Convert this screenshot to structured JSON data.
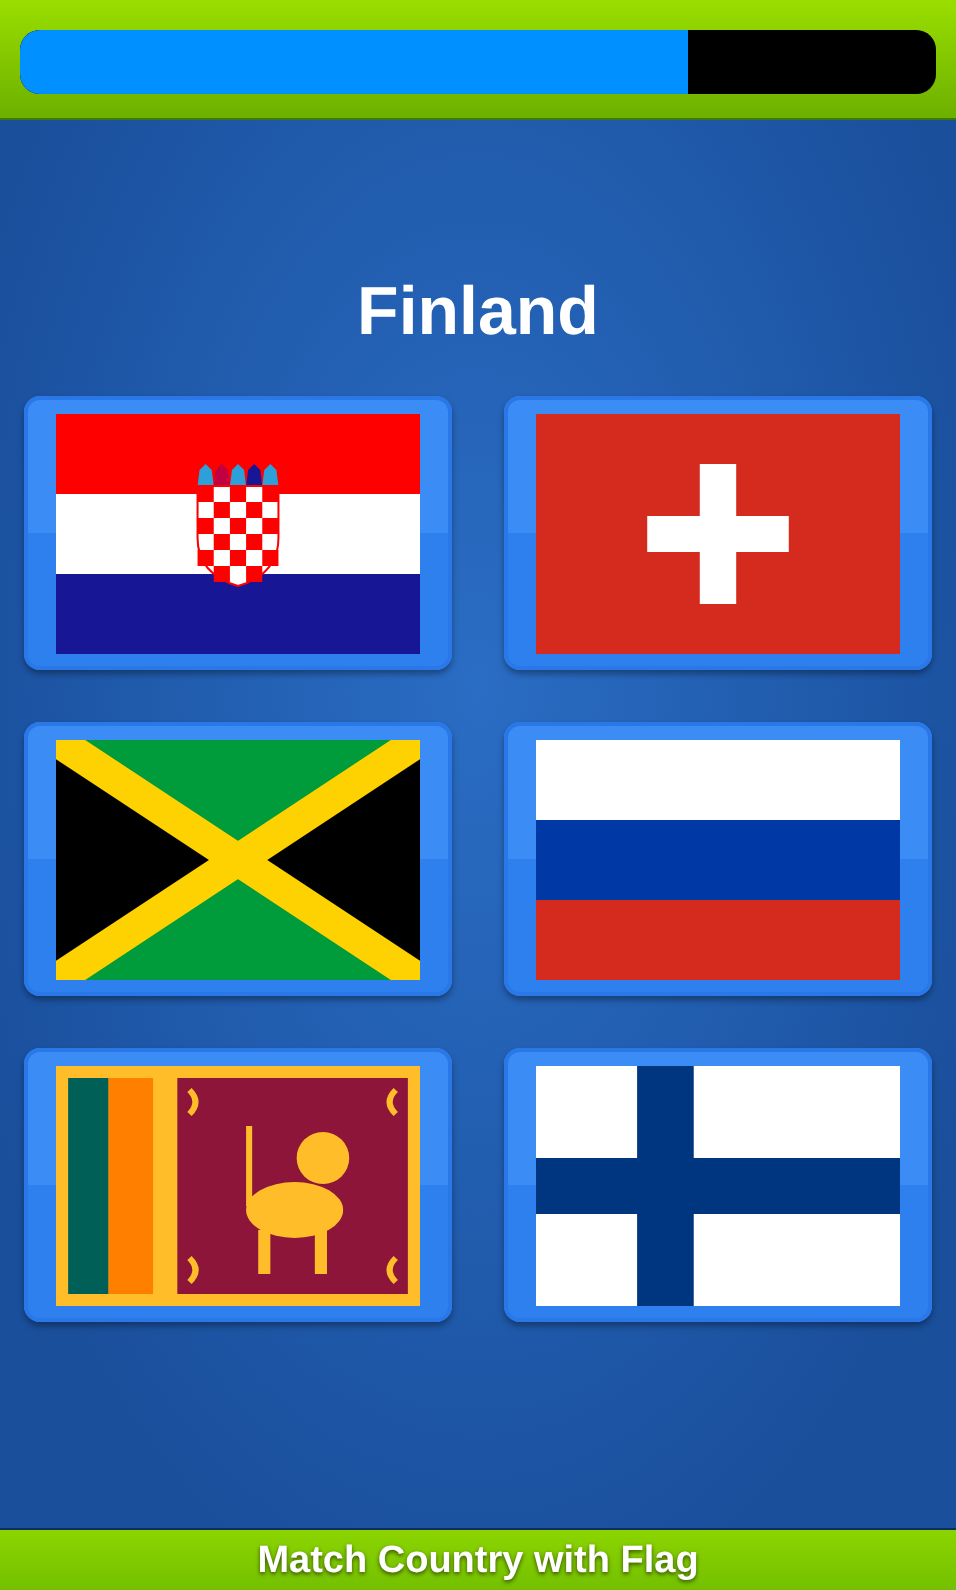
{
  "progress": {
    "level": 0.73
  },
  "question": "Finland",
  "options": [
    {
      "kind": "croatia"
    },
    {
      "kind": "switzerland"
    },
    {
      "kind": "jamaica"
    },
    {
      "kind": "russia"
    },
    {
      "kind": "sri-lanka"
    },
    {
      "kind": "finland"
    }
  ],
  "footer": "Match Country with Flag"
}
